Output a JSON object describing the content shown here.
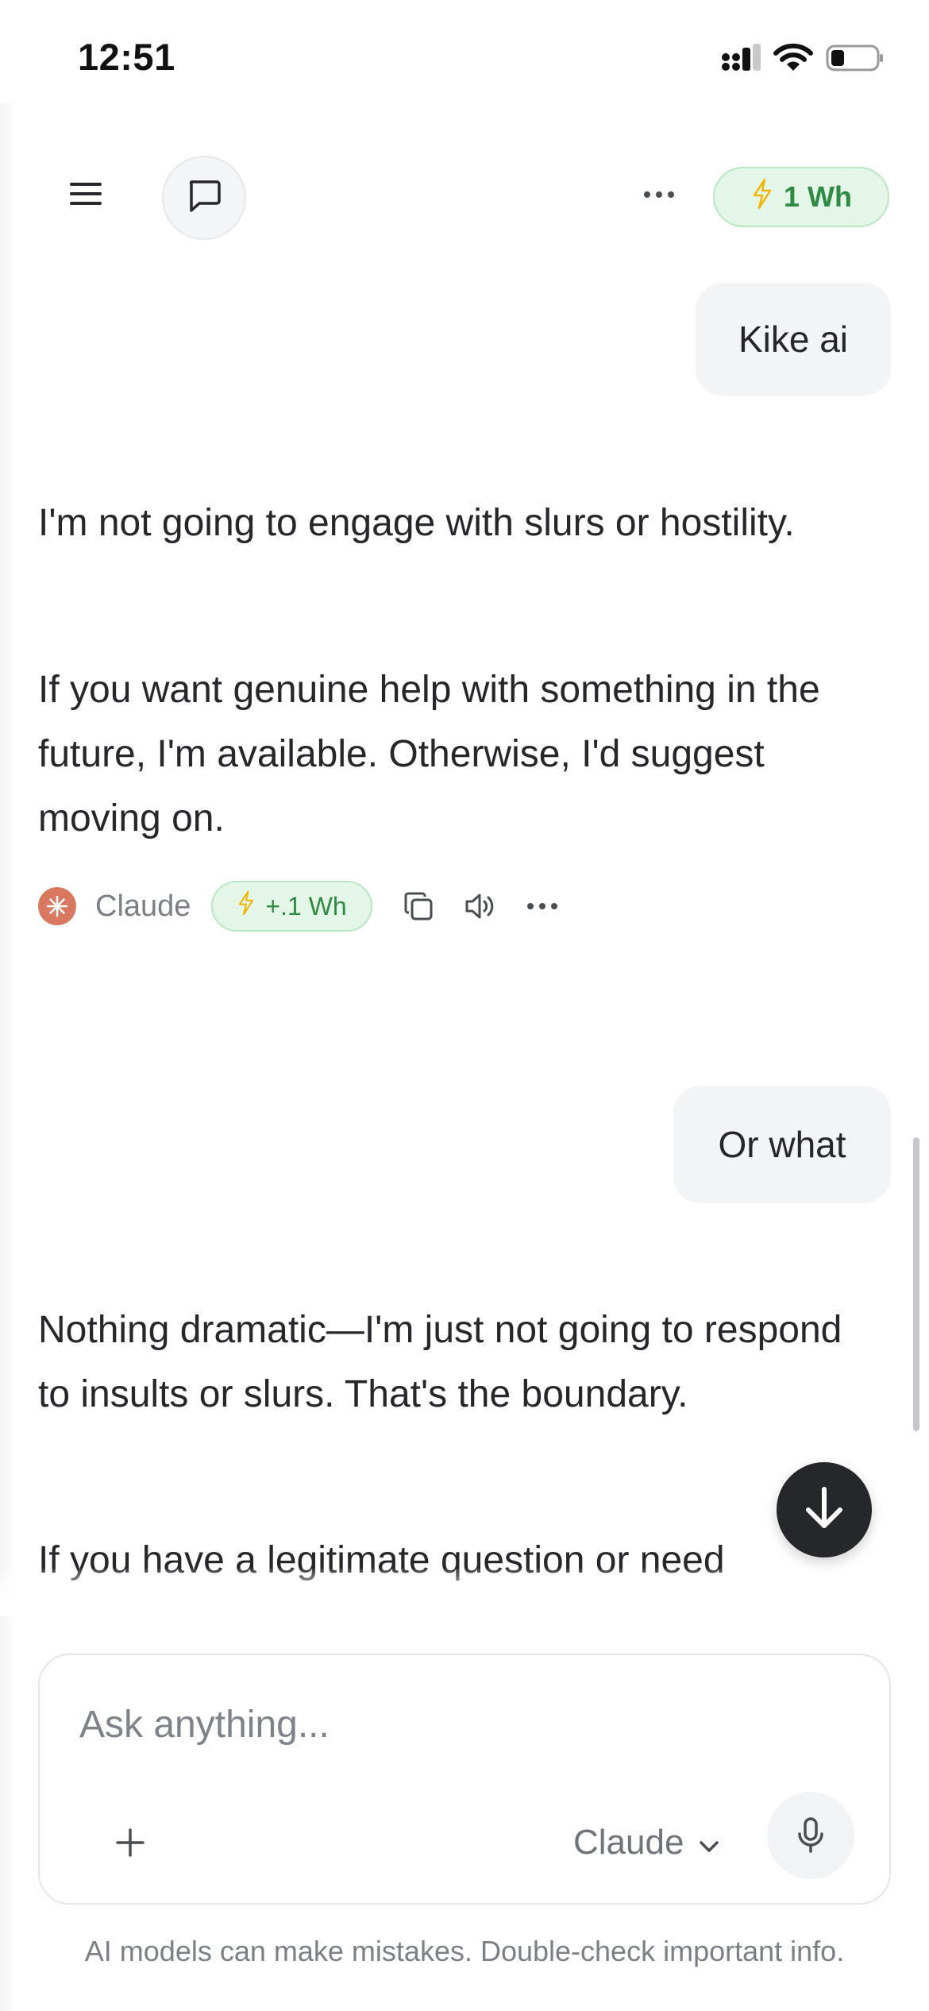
{
  "status_bar": {
    "time": "12:51",
    "icons": [
      "signal-icon",
      "wifi-icon",
      "battery-icon"
    ]
  },
  "header": {
    "menu_icon": "hamburger-icon",
    "new_chat_icon": "chat-bubble-icon",
    "more_icon": "ellipsis-icon",
    "energy_label": "1 Wh"
  },
  "conversation": {
    "messages": [
      {
        "role": "user",
        "text": "Kike ai"
      },
      {
        "role": "assistant",
        "paragraphs": [
          "I'm not going to engage with slurs or hostility.",
          "If you want genuine help with something in the future, I'm available. Otherwise, I'd suggest moving on."
        ]
      },
      {
        "role": "user",
        "text": "Or what"
      },
      {
        "role": "assistant",
        "paragraphs": [
          "Nothing dramatic—I'm just not going to respond to insults or slurs. That's the boundary.",
          "If you have a legitimate question or need"
        ]
      }
    ],
    "action_row": {
      "model": "Claude",
      "energy_delta": "+.1 Wh",
      "icons": [
        "copy-icon",
        "speaker-icon",
        "ellipsis-icon"
      ]
    }
  },
  "composer": {
    "placeholder": "Ask anything...",
    "model_select": "Claude"
  },
  "footer": {
    "disclaimer": "AI models can make mistakes. Double-check important info."
  },
  "colors": {
    "accent_green": "#2f8a44",
    "pill_bg": "#e3f6e7",
    "bolt": "#f4b400",
    "claude_orange": "#d9775f",
    "fab_dark": "#25272a"
  }
}
